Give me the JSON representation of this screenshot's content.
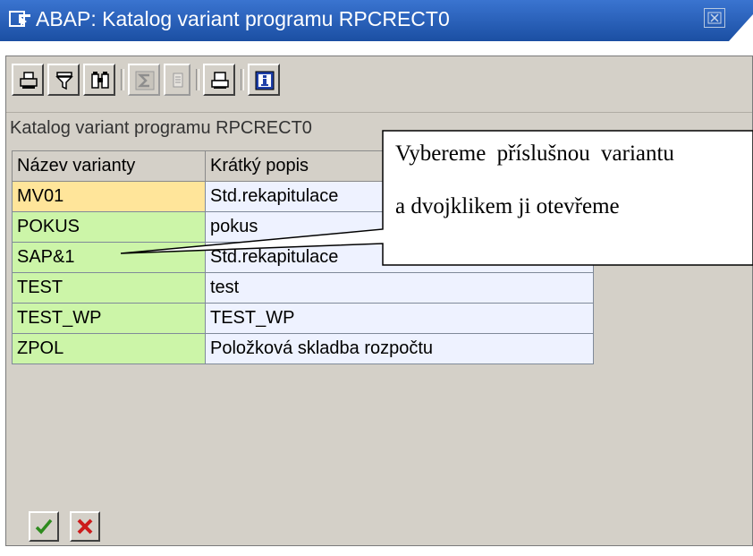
{
  "window": {
    "title": "ABAP: Katalog variant programu RPCRECT0",
    "title_icon": "window-menu-icon",
    "close_icon": "close-icon",
    "titlebar_color": "#2a5fb8"
  },
  "toolbar": {
    "buttons": [
      {
        "name": "print-icon",
        "enabled": true
      },
      {
        "name": "filter-icon",
        "enabled": true
      },
      {
        "name": "find-icon",
        "enabled": true
      },
      {
        "name": "sum-icon",
        "enabled": false
      },
      {
        "name": "subtotal-icon",
        "enabled": false
      },
      {
        "name": "print-preview-icon",
        "enabled": true
      },
      {
        "name": "info-icon",
        "enabled": true
      }
    ]
  },
  "panel": {
    "title": "Katalog variant programu RPCRECT0"
  },
  "table": {
    "columns": [
      "Název varianty",
      "Krátký popis"
    ],
    "rows": [
      {
        "name": "MV01",
        "description": "Std.rekapitulace",
        "selected": true
      },
      {
        "name": "POKUS",
        "description": "pokus",
        "selected": false
      },
      {
        "name": "SAP&1",
        "description": "Std.rekapitulace",
        "selected": false
      },
      {
        "name": "TEST",
        "description": "test",
        "selected": false
      },
      {
        "name": "TEST_WP",
        "description": "TEST_WP",
        "selected": false
      },
      {
        "name": "ZPOL",
        "description": "Položková skladba rozpočtu",
        "selected": false
      }
    ]
  },
  "footer": {
    "buttons": [
      {
        "name": "confirm-icon",
        "color": "#2e8b1e"
      },
      {
        "name": "cancel-icon",
        "color": "#cc1b1b"
      }
    ]
  },
  "callout": {
    "line1": "Vybereme příslušnou variantu",
    "line2": "a dvojklikem ji otevřeme"
  }
}
